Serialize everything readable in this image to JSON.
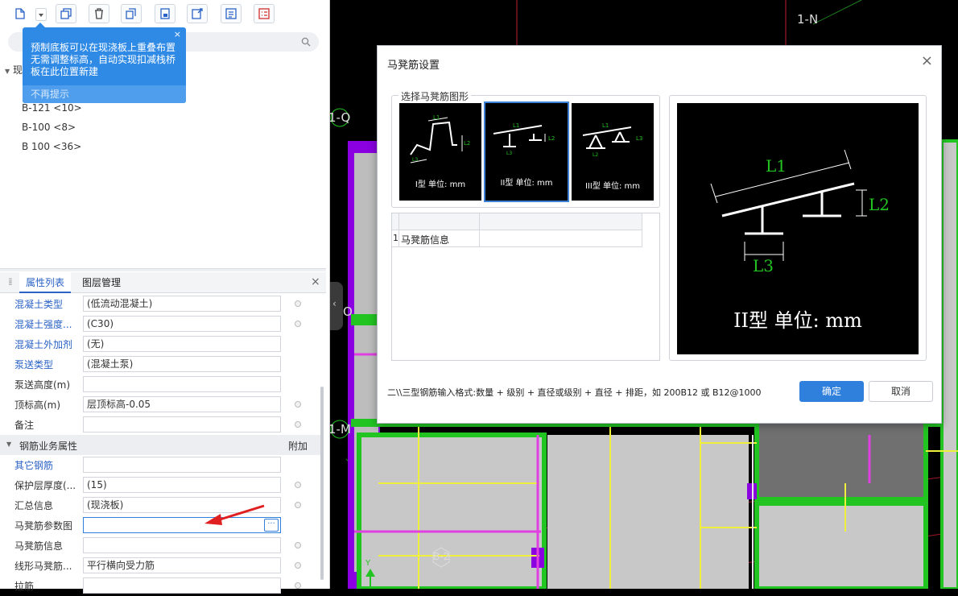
{
  "tooltip": {
    "message": "预制底板可以在现浇板上重叠布置无需调整标高，自动实现扣减栈桥板在此位置新建",
    "dismiss": "不再提示",
    "close": "×"
  },
  "tree": {
    "root": "现",
    "items": [
      "B-121 <10>",
      "B-100 <8>",
      "B 100 <36>"
    ]
  },
  "tabs": [
    "属性列表",
    "图层管理"
  ],
  "tabs_close": "×",
  "properties": [
    {
      "label": "混凝土类型",
      "value": "(低流动混凝土)",
      "blue": true,
      "dot": true
    },
    {
      "label": "混凝土强度...",
      "value": "(C30)",
      "blue": true,
      "dot": true
    },
    {
      "label": "混凝土外加剂",
      "value": "(无)",
      "blue": true,
      "dot": false
    },
    {
      "label": "泵送类型",
      "value": "(混凝土泵)",
      "blue": true,
      "dot": false
    },
    {
      "label": "泵送高度(m)",
      "value": "",
      "blue": false,
      "dot": false
    },
    {
      "label": "顶标高(m)",
      "value": "层顶标高-0.05",
      "blue": false,
      "dot": true
    },
    {
      "label": "备注",
      "value": "",
      "blue": false,
      "dot": true
    }
  ],
  "section": {
    "label": "钢筋业务属性",
    "extra": "附加"
  },
  "rebar_properties": [
    {
      "label": "其它钢筋",
      "value": "",
      "blue": true,
      "dot": false
    },
    {
      "label": "保护层厚度(...",
      "value": "(15)",
      "blue": false,
      "dot": true
    },
    {
      "label": "汇总信息",
      "value": "(现浇板)",
      "blue": false,
      "dot": true
    },
    {
      "label": "马凳筋参数图",
      "value": "",
      "blue": false,
      "dot": false,
      "active": true
    },
    {
      "label": "马凳筋信息",
      "value": "",
      "blue": false,
      "dot": true
    },
    {
      "label": "线形马凳筋...",
      "value": "平行横向受力筋",
      "blue": false,
      "dot": true
    },
    {
      "label": "拉筋",
      "value": "",
      "blue": false,
      "dot": true
    }
  ],
  "more_button": "···",
  "cad_labels": {
    "n": "1-N",
    "q": "1-Q",
    "m": "1-M",
    "o": "O",
    "b": "B-2",
    "y": "Y"
  },
  "dialog": {
    "title": "马凳筋设置",
    "close": "×",
    "shape_group_label": "选择马凳筋图形",
    "shapes": [
      {
        "caption": "I型 单位: mm"
      },
      {
        "caption": "II型 单位: mm"
      },
      {
        "caption": "III型 单位: mm"
      }
    ],
    "grid_row_num": "1",
    "grid_row_label": "马凳筋信息",
    "preview": {
      "l1": "L1",
      "l2": "L2",
      "l3": "L3",
      "caption": "II型 单位: mm"
    },
    "hint": "二\\\\三型钢筋输入格式:数量 + 级别 + 直径或级别 + 直径 + 排距，如 200B12 或 B12@1000",
    "ok": "确定",
    "cancel": "取消"
  },
  "colors": {
    "accent": "#2f7fdc",
    "tooltip": "#2f8ae6",
    "cad_green": "#22c422",
    "cad_yellow": "#f0f03c",
    "cad_magenta": "#e040e0",
    "cad_purple": "#8a00e0"
  }
}
